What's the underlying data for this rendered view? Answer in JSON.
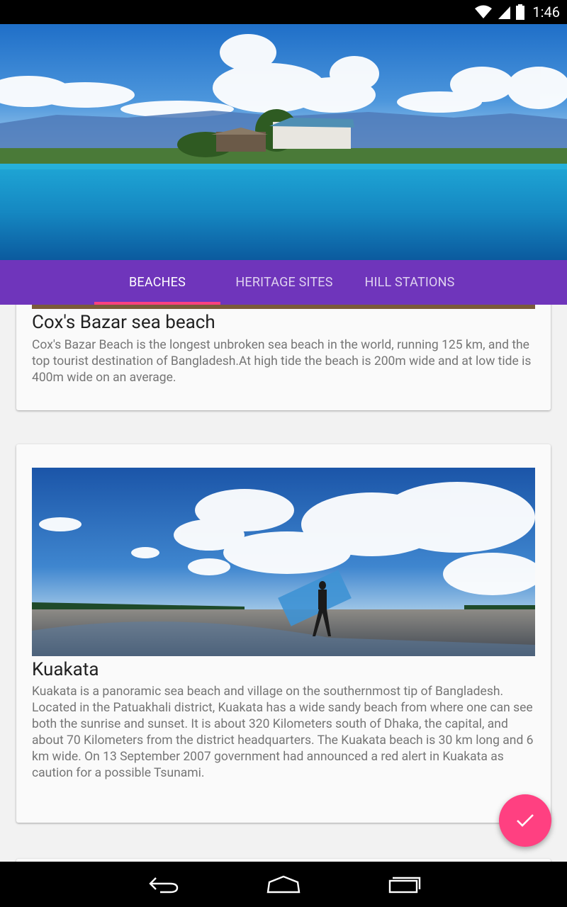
{
  "status_bar": {
    "time": "1:46",
    "icons": [
      "wifi-icon",
      "signal-icon",
      "battery-icon"
    ]
  },
  "tabs": [
    {
      "label": "BEACHES",
      "active": true
    },
    {
      "label": "HERITAGE SITES",
      "active": false
    },
    {
      "label": "HILL STATIONS",
      "active": false
    }
  ],
  "cards": [
    {
      "title": "Cox's Bazar sea beach",
      "description": "Cox's Bazar Beach is the longest unbroken sea beach in the world, running 125 km, and the top tourist destination of Bangladesh.At high tide the beach is 200m wide and at low tide is 400m wide on an average."
    },
    {
      "title": "Kuakata",
      "description": "Kuakata is a panoramic sea beach and village on the southernmost tip of Bangladesh. Located in the Patuakhali district, Kuakata has a wide sandy beach from where one can see both the sunrise and sunset. It is about 320 Kilometers south of Dhaka, the capital, and about 70 Kilometers from the district headquarters. The Kuakata beach is 30 km long and 6 km wide. On 13 September 2007 government had announced a red alert in Kuakata as caution for a possible Tsunami."
    }
  ],
  "fab": {
    "icon": "check-icon"
  },
  "nav_bar": {
    "icons": [
      "back-icon",
      "home-icon",
      "recents-icon"
    ]
  },
  "colors": {
    "primary": "#6f35bb",
    "accent": "#ff4081",
    "card_background": "#fafafa",
    "page_background": "#f2f2f2"
  }
}
